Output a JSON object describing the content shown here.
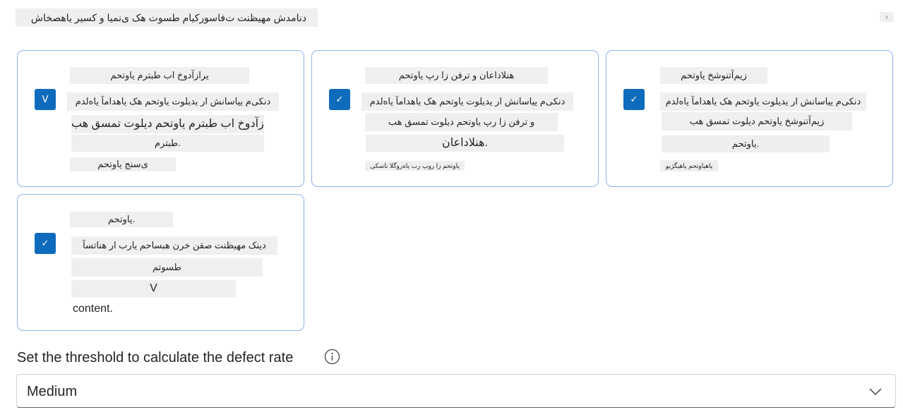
{
  "header": {
    "title": "دنامدش مهیظنت ت‌فاسورکیام طسوت هک ی‌نمیا و کسیر یاهصخاش",
    "corner_text": "ı"
  },
  "cards": [
    {
      "checkbox_glyph": "V",
      "lines": [
        "یرازآدوخ اب طبترم یاوتحم",
        "دنکی‌م ییاسانش ار یدیلوت یاوتحم هک یا‌هدامآ یاه‌لدم",
        "یرازآدوخ اب طبترم یاوتحم دیلوت تمسق هب",
        "طبترم.",
        "ی‌سنج یاوتحم"
      ]
    },
    {
      "checkbox_glyph": "✓",
      "lines": [
        "هنلاداعان و ترفن زا رپ یاوتحم",
        "دنکی‌م ییاسانش ار یدیلوت یاوتحم هک یا‌هدامآ یاه‌لدم",
        "و ترفن زا رپ یاوتحم دیلوت تمسق هب",
        "هنلاداعان.",
        "یاوتحم زا روپ رب یاه‌روگلا ناسکی"
      ]
    },
    {
      "checkbox_glyph": "✓",
      "lines": [
        "زیم‌آتنوشخ یاوتحم",
        "دنکی‌م ییاسانش ار یدیلوت یاوتحم هک یا‌هدامآ یاه‌لدم",
        "زیم‌آتنوشخ یاوتحم دیلوت تمسق هب",
        "یاوتحم.",
        "یاهیاوتحم یاهیگژیو"
      ]
    },
    {
      "checkbox_glyph": "✓",
      "lines": [
        "یاوتحم.",
        "دینک مهیظنت صقن خرن هبساحم یارب ار هناتسآ",
        "طسوتم",
        "V",
        "content."
      ]
    }
  ],
  "threshold": {
    "label": "Set the threshold to calculate the defect rate",
    "selected": "Medium"
  },
  "colors": {
    "accent": "#0f6cbd",
    "card_border": "#8ab4ea",
    "highlight": "#efefef"
  }
}
